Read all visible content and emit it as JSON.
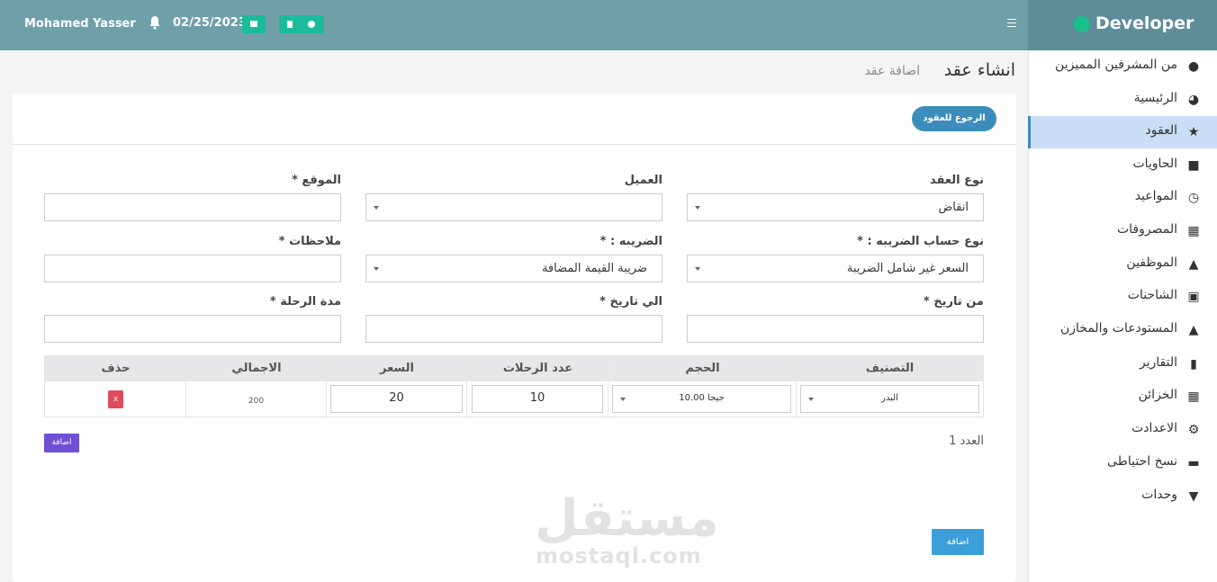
{
  "header": {
    "user_name": "Mohamed Yasser",
    "date": "02/25/2023",
    "icons": [
      "bell-icon",
      "money-icon",
      "calculator-icon",
      "plus-circle-icon",
      "hamburger-icon"
    ]
  },
  "brand": {
    "name": "Developer"
  },
  "sidebar": {
    "items": [
      {
        "label": "من المشرفين المميزين",
        "icon": "users-icon"
      },
      {
        "label": "الرئيسية",
        "icon": "dashboard-icon"
      },
      {
        "label": "العقود",
        "icon": "star-icon",
        "active": true
      },
      {
        "label": "الحاويات",
        "icon": "train-icon"
      },
      {
        "label": "المواعيد",
        "icon": "clock-icon"
      },
      {
        "label": "المصروفات",
        "icon": "cash-register-icon"
      },
      {
        "label": "الموظفين",
        "icon": "user-tie-icon"
      },
      {
        "label": "الشاحنات",
        "icon": "truck-icon"
      },
      {
        "label": "المستودعات والمخازن",
        "icon": "warehouse-icon"
      },
      {
        "label": "التقارير",
        "icon": "file-icon"
      },
      {
        "label": "الخزائن",
        "icon": "safe-icon"
      },
      {
        "label": "الاعدادت",
        "icon": "gear-icon"
      },
      {
        "label": "نسخ احتياطى",
        "icon": "hdd-icon"
      },
      {
        "label": "وحدات",
        "icon": "plug-icon"
      }
    ]
  },
  "page": {
    "title": "انشاء عقد",
    "subtitle": "اضافة عقد"
  },
  "card": {
    "back_button": "الرجوع للعقود"
  },
  "form": {
    "contract_type": {
      "label": "نوع العقد",
      "value": "انقاض"
    },
    "client": {
      "label": "العميل",
      "value": ""
    },
    "location": {
      "label": "الموقع *",
      "value": ""
    },
    "tax_calc_type": {
      "label": "نوع حساب الضريبه : *",
      "value": "السعر غير شامل الضريبة"
    },
    "tax": {
      "label": "الضريبه : *",
      "value": "ضريبة القيمة المضافة"
    },
    "notes": {
      "label": "ملاحظات *",
      "value": ""
    },
    "from_date": {
      "label": "من تاريخ *",
      "value": ""
    },
    "to_date": {
      "label": "الي تاريخ *",
      "value": ""
    },
    "trip_duration": {
      "label": "مدة الرحلة *",
      "value": ""
    }
  },
  "table": {
    "headers": {
      "category": "التصنيف",
      "size": "الحجم",
      "trips": "عدد الرحلات",
      "price": "السعر",
      "total": "الاجمالي",
      "delete": "حذف"
    },
    "rows": [
      {
        "category": "البدر",
        "size": "10.00 جيجا",
        "trips": "10",
        "price": "20",
        "total": "200",
        "delete": "x"
      }
    ]
  },
  "count_label": "العدد 1",
  "add_row_button": "اضافة",
  "submit_button": "اضافة",
  "watermark": {
    "arabic": "مستقل",
    "latin": "mostaql.com"
  },
  "colors": {
    "topbar": "#6f9fa9",
    "brand": "#5c8d98",
    "accent": "#3c8dbc",
    "active_item": "#c9ddf4",
    "delete": "#dd4b5c",
    "add_row": "#6f4fd6",
    "green": "#1abc9c"
  }
}
